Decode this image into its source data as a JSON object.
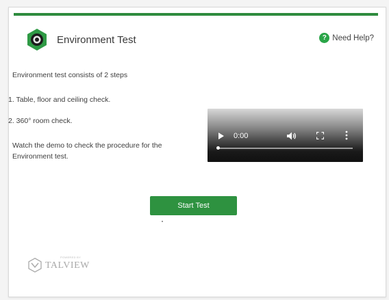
{
  "header": {
    "title": "Environment Test",
    "help_label": "Need Help?",
    "help_icon_glyph": "?"
  },
  "content": {
    "intro": "Environment test consists of 2 steps",
    "steps": [
      "1.  Table, floor and ceiling check.",
      "2.  360° room check."
    ],
    "demo_note": "Watch the demo to check the procedure for the Environment test."
  },
  "video": {
    "time": "0:00",
    "progress": 0
  },
  "actions": {
    "start_label": "Start Test"
  },
  "footer": {
    "powered_by": "POWERED BY",
    "brand": "TALVIEW"
  },
  "colors": {
    "accent": "#2e9240",
    "rule": "#2e8b3e",
    "help": "#2aa548"
  },
  "icons": {
    "app": "webcam-hexagon-icon",
    "help": "question-circle-icon",
    "play": "play-icon",
    "volume": "volume-icon",
    "fullscreen": "fullscreen-icon",
    "more": "more-vertical-icon",
    "logo": "talview-logo-icon"
  }
}
